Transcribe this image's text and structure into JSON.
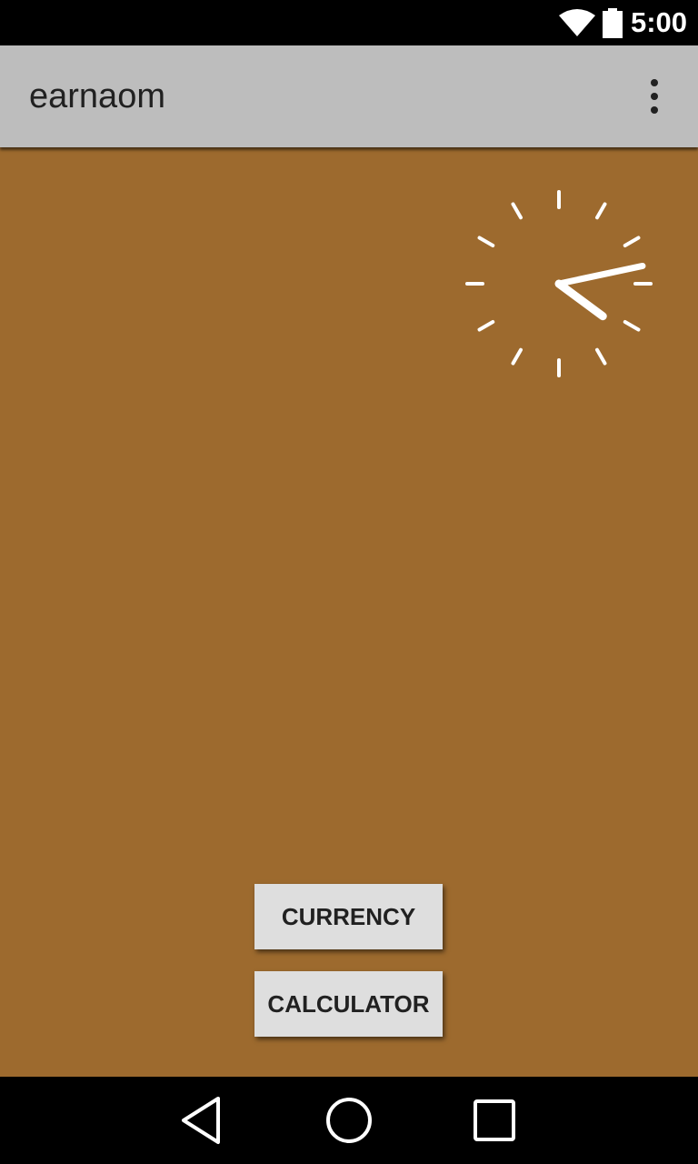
{
  "status_bar": {
    "time": "5:00",
    "icons": [
      "wifi-icon",
      "battery-icon"
    ]
  },
  "app_bar": {
    "title": "earnaom",
    "overflow_icon": "more-vert-icon"
  },
  "clock": {
    "type": "analog",
    "hour": 4,
    "minute": 13
  },
  "buttons": {
    "currency": "CURRENCY",
    "calculator": "CALCULATOR"
  },
  "nav_bar": {
    "icons": [
      "back-icon",
      "home-icon",
      "recents-icon"
    ]
  },
  "colors": {
    "background": "#9d6a2e",
    "app_bar": "#bdbdbd",
    "button": "#dedede",
    "clock_marks": "#ffffff"
  }
}
